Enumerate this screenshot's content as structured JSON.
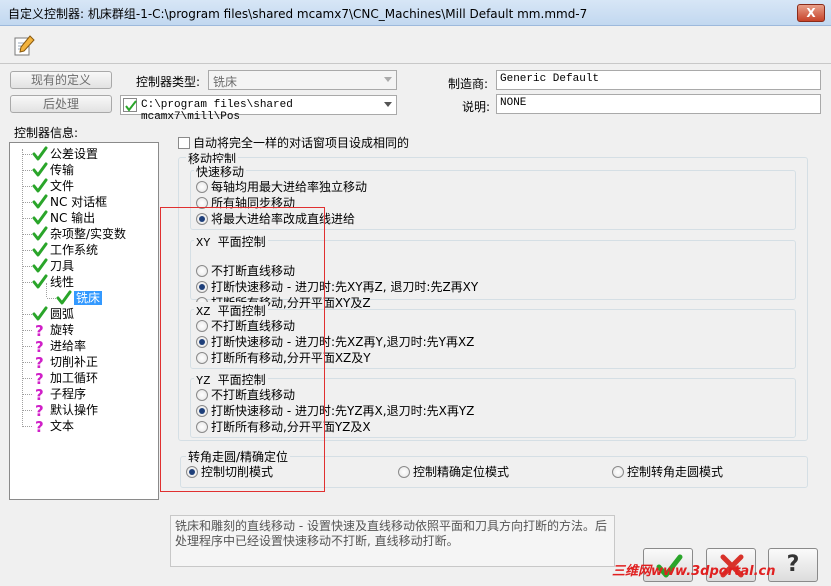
{
  "window": {
    "title": "自定义控制器: 机床群组-1-C:\\program files\\shared mcamx7\\CNC_Machines\\Mill Default mm.mmd-7",
    "close_label": "X"
  },
  "left_buttons": {
    "current_definition": "现有的定义",
    "post_processor": "后处理"
  },
  "controller": {
    "type_label": "控制器类型:",
    "type_value": "铣床",
    "post_path": "C:\\program files\\shared mcamx7\\mill\\Pos"
  },
  "manufacturer": {
    "label": "制造商:",
    "value": "Generic Default"
  },
  "description": {
    "label": "说明:",
    "value": "NONE"
  },
  "tree": {
    "header": "控制器信息:",
    "items": [
      {
        "label": "公差设置",
        "status": "check"
      },
      {
        "label": "传输",
        "status": "check"
      },
      {
        "label": "文件",
        "status": "check"
      },
      {
        "label": "NC 对话框",
        "status": "check"
      },
      {
        "label": "NC 输出",
        "status": "check"
      },
      {
        "label": "杂项整/实变数",
        "status": "check"
      },
      {
        "label": "工作系统",
        "status": "check"
      },
      {
        "label": "刀具",
        "status": "check"
      },
      {
        "label": "线性",
        "status": "check"
      },
      {
        "label": "铣床",
        "status": "check",
        "child": true,
        "selected": true
      },
      {
        "label": "圆弧",
        "status": "check"
      },
      {
        "label": "旋转",
        "status": "question"
      },
      {
        "label": "进给率",
        "status": "question"
      },
      {
        "label": "切削补正",
        "status": "question"
      },
      {
        "label": "加工循环",
        "status": "question"
      },
      {
        "label": "子程序",
        "status": "question"
      },
      {
        "label": "默认操作",
        "status": "question"
      },
      {
        "label": "文本",
        "status": "question"
      }
    ]
  },
  "same_dialog_checkbox": "自动将完全一样的对话窗项目设成相同的",
  "motion": {
    "title": "移动控制",
    "rapid": {
      "title": "快速移动",
      "options": [
        "每轴均用最大进给率独立移动",
        "所有轴同步移动",
        "将最大进给率改成直线进给"
      ],
      "selected": 2
    },
    "xy": {
      "title": "XY 平面控制",
      "options": [
        "不打断直线移动",
        "打断快速移动 - 进刀时:先XY再Z, 退刀时:先Z再XY",
        "打断所有移动,分开平面XY及Z"
      ],
      "selected": 1
    },
    "xz": {
      "title": "XZ 平面控制",
      "options": [
        "不打断直线移动",
        "打断快速移动 - 进刀时:先XZ再Y,退刀时:先Y再XZ",
        "打断所有移动,分开平面XZ及Y"
      ],
      "selected": 1
    },
    "yz": {
      "title": "YZ 平面控制",
      "options": [
        "不打断直线移动",
        "打断快速移动 - 进刀时:先YZ再X,退刀时:先X再YZ",
        "打断所有移动,分开平面YZ及X"
      ],
      "selected": 1
    }
  },
  "corner": {
    "title": "转角走圆/精确定位",
    "options": [
      "控制切削模式",
      "控制精确定位模式",
      "控制转角走圆模式"
    ],
    "selected": 0
  },
  "help_text": "铣床和雕刻的直线移动 - 设置快速及直线移动依照平面和刀具方向打断的方法。后处理程序中已经设置快速移动不打断, 直线移动打断。",
  "buttons": {
    "help_label": "?"
  },
  "watermark": "三维网www.3dportal.cn",
  "colors": {
    "check": "#2aa52a",
    "question": "#d020c8",
    "cancel": "#d8322a",
    "selection": "#3399ff",
    "highlight_box": "#e03030"
  }
}
